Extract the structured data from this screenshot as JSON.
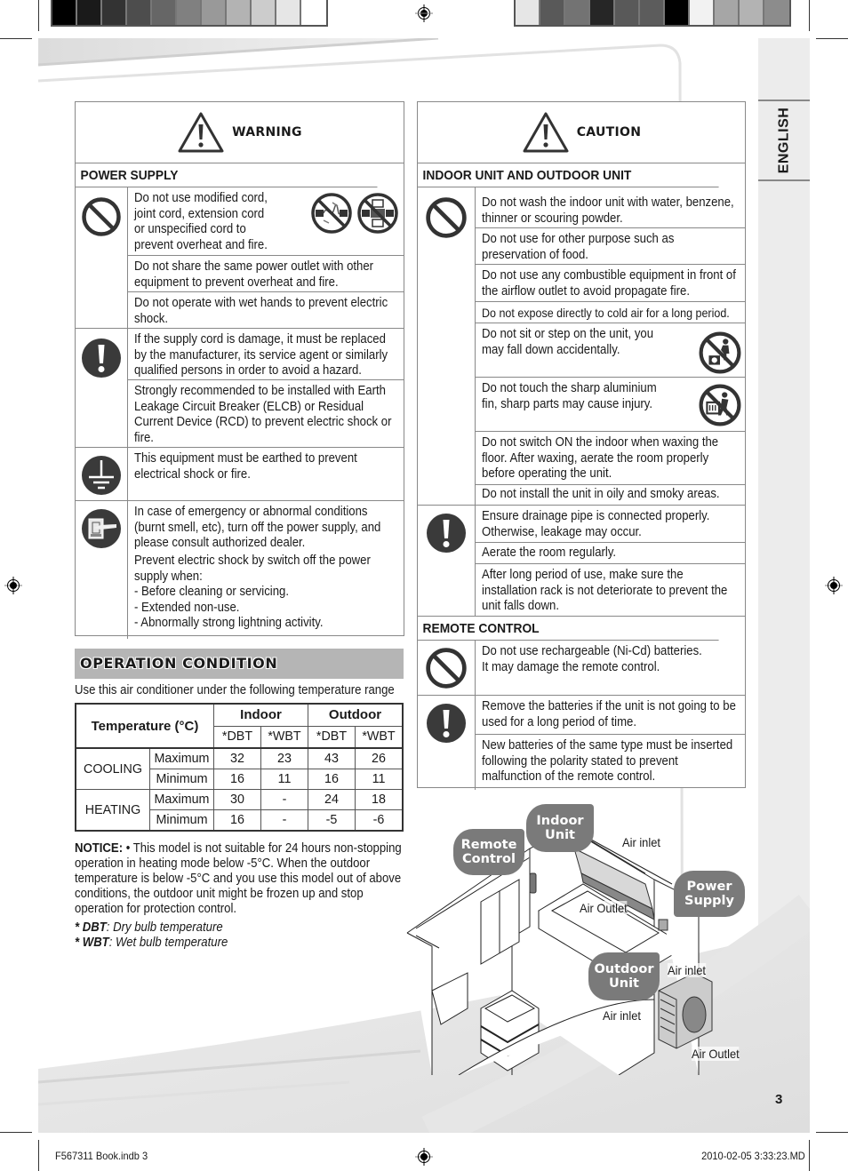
{
  "print_marks": {
    "swatches_left": [
      "#000000",
      "#1a1a1a",
      "#333333",
      "#4d4d4d",
      "#666666",
      "#808080",
      "#999999",
      "#b3b3b3",
      "#cccccc",
      "#e6e6e6",
      "#ffffff"
    ],
    "swatches_right": [
      "#e6e6e6",
      "#595959",
      "#737373",
      "#262626",
      "#595959",
      "#5c5c5c",
      "#000000",
      "#f2f2f2",
      "#a6a6a6",
      "#b3b3b3",
      "#8c8c8c"
    ]
  },
  "language_tab": "ENGLISH",
  "warning": {
    "title": "WARNING",
    "sections": [
      {
        "heading": "POWER SUPPLY",
        "groups": [
          {
            "icon": "prohibition-icon",
            "items": [
              "Do not use modified cord, joint cord, extension cord or unspecified cord to prevent overheat and fire.",
              "Do not share the same power outlet with other equipment to prevent overheat and fire.",
              "Do not operate with wet hands to prevent electric shock."
            ]
          },
          {
            "icon": "mandatory-exclamation-icon",
            "items": [
              "If the supply cord is damage, it must be replaced by the manufacturer, its service agent or similarly qualified persons in order to avoid a hazard.",
              "Strongly recommended to be installed with Earth Leakage Circuit Breaker (ELCB) or Residual Current Device (RCD) to prevent electric shock or fire."
            ]
          },
          {
            "icon": "earth-ground-icon",
            "items": [
              "This equipment must be earthed to prevent electrical shock or fire."
            ]
          },
          {
            "icon": "switch-off-power-icon",
            "items": [
              "In case of emergency or abnormal conditions (burnt smell, etc), turn off the power supply, and please consult authorized dealer.",
              "Prevent electric shock by switch off the power supply when:\n- Before cleaning or servicing.\n- Extended non-use.\n- Abnormally strong lightning activity."
            ]
          }
        ]
      }
    ]
  },
  "caution": {
    "title": "CAUTION",
    "sections": [
      {
        "heading": "INDOOR UNIT AND OUTDOOR UNIT",
        "groups": [
          {
            "icon": "prohibition-icon",
            "items": [
              "Do not wash the indoor unit with water, benzene, thinner or scouring powder.",
              "Do not use for other purpose such as preservation of food.",
              "Do not use any combustible equipment in front of the airflow outlet to avoid propagate fire.",
              "Do not expose directly to cold air for a long period.",
              "Do not sit or step on the unit, you may fall down accidentally.",
              "Do not touch the sharp aluminium fin, sharp parts may cause injury.",
              "Do not switch ON the indoor when waxing the floor. After waxing, aerate the room properly before operating the unit.",
              "Do not install the unit in oily and smoky areas."
            ]
          },
          {
            "icon": "mandatory-exclamation-icon",
            "items": [
              "Ensure drainage pipe is connected properly. Otherwise, leakage may occur.",
              "Aerate the room regularly.",
              "After long period of use, make sure the installation rack is not deteriorate to prevent the unit falls down."
            ]
          }
        ]
      },
      {
        "heading": "REMOTE CONTROL",
        "groups": [
          {
            "icon": "prohibition-icon",
            "items": [
              "Do not use rechargeable (Ni-Cd) batteries.\nIt may damage the remote control."
            ]
          },
          {
            "icon": "mandatory-exclamation-icon",
            "items": [
              "Remove the batteries if the unit is not going to be used for a long period of time.",
              "New batteries of the same type must be inserted following the polarity stated to prevent malfunction of the remote control."
            ]
          }
        ]
      }
    ]
  },
  "operation_condition": {
    "title": "OPERATION CONDITION",
    "intro": "Use this air conditioner under the following temperature range",
    "table": {
      "header_temp": "Temperature (°C)",
      "header_indoor": "Indoor",
      "header_outdoor": "Outdoor",
      "sub_headers": [
        "*DBT",
        "*WBT",
        "*DBT",
        "*WBT"
      ],
      "rows": [
        {
          "mode": "COOLING",
          "limit": "Maximum",
          "values": [
            "32",
            "23",
            "43",
            "26"
          ]
        },
        {
          "mode": "COOLING",
          "limit": "Minimum",
          "values": [
            "16",
            "11",
            "16",
            "11"
          ]
        },
        {
          "mode": "HEATING",
          "limit": "Maximum",
          "values": [
            "30",
            "-",
            "24",
            "18"
          ]
        },
        {
          "mode": "HEATING",
          "limit": "Minimum",
          "values": [
            "16",
            "-",
            "-5",
            "-6"
          ]
        }
      ]
    },
    "notice_label": "NOTICE:",
    "notice_text": " • This model is not suitable for 24 hours non-stopping operation in heating mode below -5°C. When the outdoor temperature is below -5°C and you use this model out of above conditions, the outdoor unit might be frozen up and stop operation for protection control.",
    "legend": [
      {
        "abbr": "* DBT",
        "desc": ":  Dry bulb temperature"
      },
      {
        "abbr": "* WBT",
        "desc": ":  Wet bulb temperature"
      }
    ]
  },
  "diagram": {
    "bubbles": {
      "indoor_unit": "Indoor\nUnit",
      "remote_control": "Remote\nControl",
      "power_supply": "Power\nSupply",
      "outdoor_unit": "Outdoor\nUnit"
    },
    "labels": {
      "indoor_air_inlet": "Air inlet",
      "indoor_air_outlet": "Air Outlet",
      "outdoor_air_inlet_top": "Air inlet",
      "outdoor_air_inlet_side": "Air inlet",
      "outdoor_air_outlet": "Air Outlet"
    }
  },
  "page_number": "3",
  "footer": {
    "file": "F567311 Book.indb   3",
    "timestamp": "2010-02-05   3:33:23.MD"
  }
}
